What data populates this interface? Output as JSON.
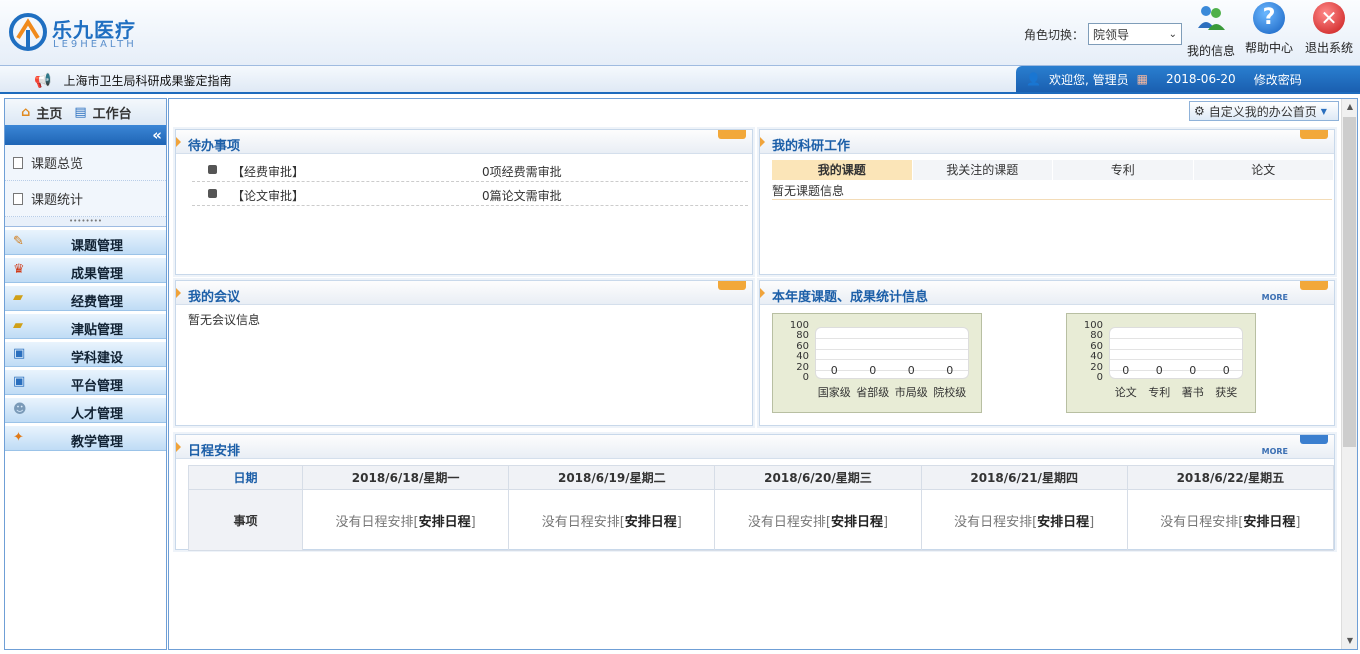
{
  "logo": {
    "cn": "乐九医疗",
    "en": "LE9HEALTH"
  },
  "header": {
    "role_label": "角色切换：",
    "role_value": "院领导",
    "buttons": [
      {
        "label": "我的信息",
        "icon": "users-icon"
      },
      {
        "label": "帮助中心",
        "icon": "help-icon"
      },
      {
        "label": "退出系统",
        "icon": "exit-icon"
      }
    ]
  },
  "notice": "上海市卫生局科研成果鉴定指南",
  "userbar": {
    "welcome": "欢迎您, 管理员",
    "date": "2018-06-20",
    "change_password": "修改密码"
  },
  "sidebar": {
    "tabs": [
      "主页",
      "工作台"
    ],
    "collapse": "«",
    "sub_items": [
      "课题总览",
      "课题统计"
    ],
    "menu": [
      "课题管理",
      "成果管理",
      "经费管理",
      "津贴管理",
      "学科建设",
      "平台管理",
      "人才管理",
      "教学管理"
    ]
  },
  "main": {
    "customize": "自定义我的办公首页",
    "panels": {
      "todo": {
        "title": "待办事项",
        "items": [
          {
            "label": "【经费审批】",
            "value": "0项经费需审批"
          },
          {
            "label": "【论文审批】",
            "value": "0篇论文需审批"
          }
        ]
      },
      "research": {
        "title": "我的科研工作",
        "tabs": [
          "我的课题",
          "我关注的课题",
          "专利",
          "论文"
        ],
        "empty": "暂无课题信息"
      },
      "meeting": {
        "title": "我的会议",
        "empty": "暂无会议信息"
      },
      "stats": {
        "title": "本年度课题、成果统计信息",
        "more": "MORE"
      },
      "schedule": {
        "title": "日程安排",
        "more": "MORE",
        "date_label": "日期",
        "item_label": "事项",
        "days": [
          "2018/6/18/星期一",
          "2018/6/19/星期二",
          "2018/6/20/星期三",
          "2018/6/21/星期四",
          "2018/6/22/星期五"
        ],
        "empty_text": "没有日程安排",
        "arrange": "安排日程"
      }
    }
  },
  "chart_data": [
    {
      "type": "bar",
      "categories": [
        "国家级",
        "省部级",
        "市局级",
        "院校级"
      ],
      "values": [
        0,
        0,
        0,
        0
      ],
      "yticks": [
        100,
        80,
        60,
        40,
        20,
        0
      ],
      "ylim": [
        0,
        100
      ]
    },
    {
      "type": "bar",
      "categories": [
        "论文",
        "专利",
        "著书",
        "获奖"
      ],
      "values": [
        0,
        0,
        0,
        0
      ],
      "yticks": [
        100,
        80,
        60,
        40,
        20,
        0
      ],
      "ylim": [
        0,
        100
      ]
    }
  ]
}
